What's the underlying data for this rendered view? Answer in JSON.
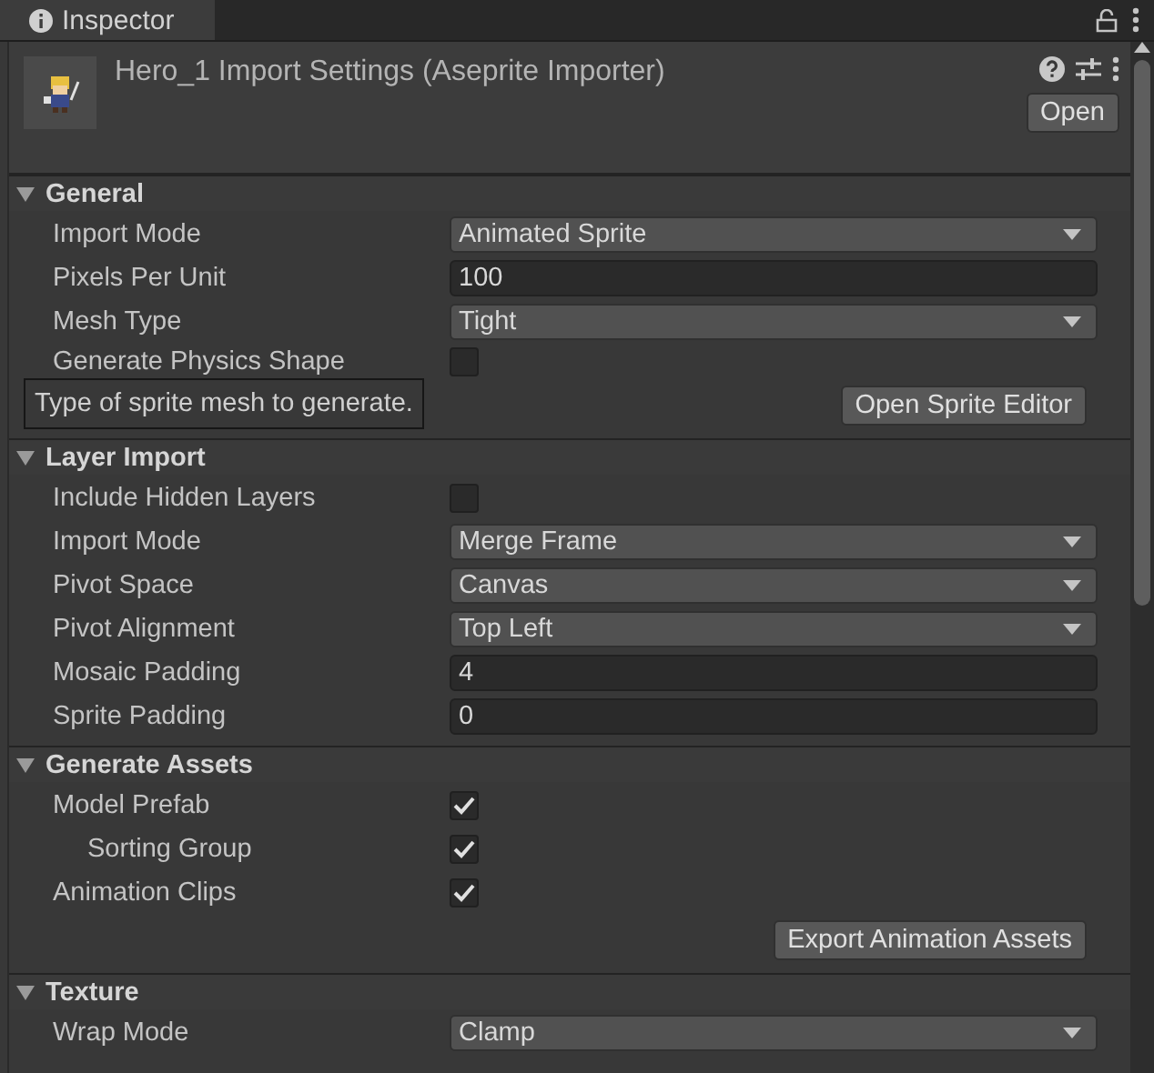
{
  "tab": {
    "label": "Inspector"
  },
  "header": {
    "title": "Hero_1 Import Settings (Aseprite Importer)",
    "open_button": "Open"
  },
  "sections": [
    {
      "title": "General",
      "expanded": true,
      "rows": [
        {
          "kind": "dropdown",
          "label": "Import Mode",
          "value": "Animated Sprite"
        },
        {
          "kind": "text",
          "label": "Pixels Per Unit",
          "value": "100"
        },
        {
          "kind": "dropdown",
          "label": "Mesh Type",
          "value": "Tight"
        },
        {
          "kind": "checkbox",
          "label": "Generate Physics Shape",
          "checked": false,
          "tooltip": "Type of sprite mesh to generate."
        },
        {
          "kind": "button",
          "label": "Open Sprite Editor"
        }
      ]
    },
    {
      "title": "Layer Import",
      "expanded": true,
      "rows": [
        {
          "kind": "checkbox",
          "label": "Include Hidden Layers",
          "checked": false
        },
        {
          "kind": "dropdown",
          "label": "Import Mode",
          "value": "Merge Frame"
        },
        {
          "kind": "dropdown",
          "label": "Pivot Space",
          "value": "Canvas"
        },
        {
          "kind": "dropdown",
          "label": "Pivot Alignment",
          "value": "Top Left"
        },
        {
          "kind": "text",
          "label": "Mosaic Padding",
          "value": "4"
        },
        {
          "kind": "text",
          "label": "Sprite Padding",
          "value": "0"
        }
      ]
    },
    {
      "title": "Generate Assets",
      "expanded": true,
      "rows": [
        {
          "kind": "checkbox",
          "label": "Model Prefab",
          "checked": true,
          "children": [
            {
              "kind": "checkbox",
              "label": "Sorting Group",
              "checked": true
            }
          ]
        },
        {
          "kind": "checkbox",
          "label": "Animation Clips",
          "checked": true
        },
        {
          "kind": "button",
          "label": "Export Animation Assets"
        }
      ]
    },
    {
      "title": "Texture",
      "expanded": true,
      "rows": [
        {
          "kind": "dropdown",
          "label": "Wrap Mode",
          "value": "Clamp"
        }
      ]
    }
  ]
}
